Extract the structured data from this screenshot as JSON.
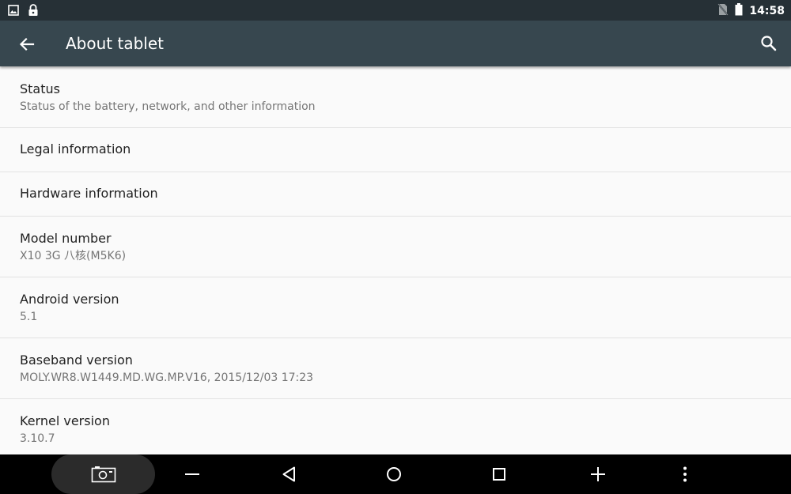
{
  "status_bar": {
    "time": "14:58",
    "left_icons": [
      "image-icon",
      "lock-icon"
    ],
    "right_icons": [
      "no-sim-icon",
      "battery-icon"
    ]
  },
  "app_bar": {
    "title": "About tablet",
    "back_icon": "back-arrow-icon",
    "search_icon": "search-icon"
  },
  "items": [
    {
      "title": "Status",
      "summary": "Status of the battery, network, and other information"
    },
    {
      "title": "Legal information"
    },
    {
      "title": "Hardware information"
    },
    {
      "title": "Model number",
      "summary": "X10 3G 八核(M5K6)"
    },
    {
      "title": "Android version",
      "summary": "5.1"
    },
    {
      "title": "Baseband version",
      "summary": "MOLY.WR8.W1449.MD.WG.MP.V16, 2015/12/03 17:23"
    },
    {
      "title": "Kernel version",
      "summary": "3.10.7"
    }
  ],
  "nav_bar": {
    "buttons": [
      "screenshot-icon",
      "volume-down-icon",
      "back-icon",
      "home-icon",
      "recents-icon",
      "volume-up-icon",
      "more-icon"
    ]
  },
  "colors": {
    "status_bar": "#263036",
    "app_bar": "#37474f",
    "background": "#fafafa",
    "nav_bar": "#000000"
  }
}
